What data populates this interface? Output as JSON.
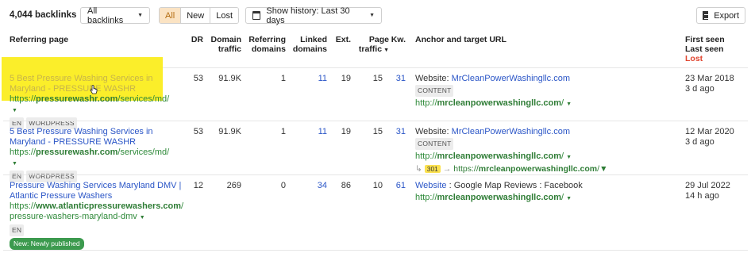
{
  "toolbar": {
    "count": "4,044 backlinks",
    "filter_label": "All backlinks",
    "segments": [
      "All",
      "New",
      "Lost"
    ],
    "history_label": "Show history: Last 30 days",
    "export_label": "Export"
  },
  "columns": {
    "referring_page": "Referring page",
    "dr": "DR",
    "domain_traffic": [
      "Domain",
      "traffic"
    ],
    "referring_domains": [
      "Referring",
      "domains"
    ],
    "linked_domains": [
      "Linked",
      "domains"
    ],
    "ext": "Ext.",
    "page_traffic": [
      "Page",
      "traffic"
    ],
    "kw": "Kw.",
    "anchor": "Anchor and target URL",
    "first_seen": "First seen",
    "last_seen": "Last seen",
    "lost": "Lost"
  },
  "rows": [
    {
      "title": [
        "5 Best Pressure Washing Services in",
        "Maryland - PRESSURE WASHR"
      ],
      "url_prefix": "https://",
      "url_domain": "pressurewashr.com",
      "url_path": "/services/md/",
      "tags": [
        "EN",
        "WORDPRESS"
      ],
      "dr": "53",
      "domain_traffic": "91.9K",
      "referring_domains": "1",
      "linked_domains": "11",
      "ext": "19",
      "page_traffic": "15",
      "kw": "31",
      "anchor_prefix": "Website: ",
      "anchor_link": "MrCleanPowerWashingllc.com",
      "anchor_tag": "CONTENT",
      "target_prefix": "http://",
      "target_domain": "mrcleanpowerwashingllc.com",
      "target_path": "/",
      "first_seen": "23 Mar 2018",
      "last_seen": "3 d ago"
    },
    {
      "title": [
        "5 Best Pressure Washing Services in",
        "Maryland - PRESSURE WASHR"
      ],
      "url_prefix": "https://",
      "url_domain": "pressurewashr.com",
      "url_path": "/services/md/",
      "tags": [
        "EN",
        "WORDPRESS"
      ],
      "dr": "53",
      "domain_traffic": "91.9K",
      "referring_domains": "1",
      "linked_domains": "11",
      "ext": "19",
      "page_traffic": "15",
      "kw": "31",
      "anchor_prefix": "Website: ",
      "anchor_link": "MrCleanPowerWashingllc.com",
      "anchor_tag": "CONTENT",
      "target_prefix": "http://",
      "target_domain": "mrcleanpowerwashingllc.com",
      "target_path": "/",
      "redirect_code": "301",
      "redirect_prefix": "https://",
      "redirect_domain": "mrcleanpowerwashingllc.com",
      "redirect_path": "/",
      "first_seen": "12 Mar 2020",
      "last_seen": "3 d ago"
    },
    {
      "title": [
        "Pressure Washing Services Maryland DMV |",
        "Atlantic Pressure Washers"
      ],
      "url_prefix": "https://",
      "url_domain": "www.atlanticpressurewashers.com",
      "url_path": "/",
      "url_path2": "pressure-washers-maryland-dmv",
      "tags": [
        "EN"
      ],
      "new_badge": "New: Newly published",
      "dr": "12",
      "domain_traffic": "269",
      "referring_domains": "0",
      "linked_domains": "34",
      "ext": "86",
      "page_traffic": "10",
      "kw": "61",
      "anchor_link": "Website",
      "anchor_suffix": " : Google Map Reviews : Facebook",
      "target_prefix": "http://",
      "target_domain": "mrcleanpowerwashingllc.com",
      "target_path": "/",
      "first_seen": "29 Jul 2022",
      "last_seen": "14 h ago"
    }
  ],
  "colors": {
    "link": "#2b56c7",
    "url_green": "#2f8a3a",
    "active_segment": "#fbe3c3",
    "lost": "#e0452f",
    "highlight": "#fbee2a",
    "redirect_badge": "#fbe14f",
    "new_badge": "#3c9a4e"
  }
}
